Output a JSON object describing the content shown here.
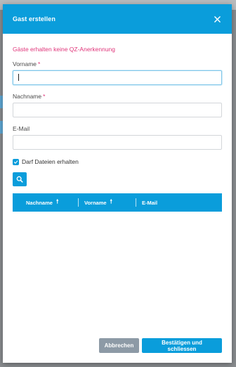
{
  "dialog": {
    "title": "Gast erstellen",
    "close_icon": "close-icon",
    "warning": "Gäste erhalten keine QZ-Anerkennung"
  },
  "form": {
    "firstname": {
      "label": "Vorname",
      "required_mark": "*",
      "value": ""
    },
    "lastname": {
      "label": "Nachname",
      "required_mark": "*",
      "value": ""
    },
    "email": {
      "label": "E-Mail",
      "value": ""
    },
    "allow_files": {
      "label": "Darf Dateien erhalten",
      "checked": true
    }
  },
  "search": {
    "icon": "search-icon"
  },
  "table": {
    "columns": [
      {
        "label": "Nachname",
        "sort": "asc"
      },
      {
        "label": "Vorname",
        "sort": "asc"
      },
      {
        "label": "E-Mail"
      }
    ],
    "sort_arrow": "🠕",
    "rows": []
  },
  "footer": {
    "cancel_label": "Abbrechen",
    "confirm_label": "Bestätigen und schliessen"
  },
  "colors": {
    "accent": "#0a9ddb",
    "warning": "#e0357a",
    "cancel": "#8d9aa6"
  }
}
